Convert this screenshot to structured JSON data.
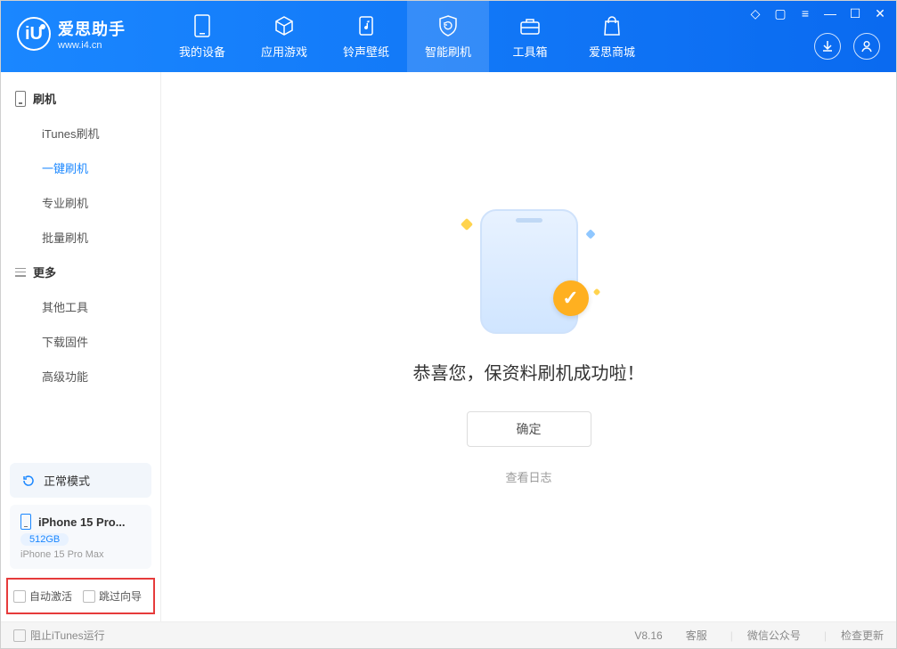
{
  "app": {
    "title": "爱思助手",
    "subtitle": "www.i4.cn",
    "logo_letter": "iU"
  },
  "nav": {
    "tabs": [
      {
        "label": "我的设备"
      },
      {
        "label": "应用游戏"
      },
      {
        "label": "铃声壁纸"
      },
      {
        "label": "智能刷机"
      },
      {
        "label": "工具箱"
      },
      {
        "label": "爱思商城"
      }
    ],
    "active_index": 3
  },
  "sidebar": {
    "section1_title": "刷机",
    "items1": [
      {
        "label": "iTunes刷机"
      },
      {
        "label": "一键刷机"
      },
      {
        "label": "专业刷机"
      },
      {
        "label": "批量刷机"
      }
    ],
    "active_item1": 1,
    "section2_title": "更多",
    "items2": [
      {
        "label": "其他工具"
      },
      {
        "label": "下载固件"
      },
      {
        "label": "高级功能"
      }
    ],
    "status": {
      "label": "正常模式"
    },
    "device": {
      "title": "iPhone 15 Pro...",
      "badge": "512GB",
      "sub": "iPhone 15 Pro Max"
    },
    "checks": {
      "auto_activate": "自动激活",
      "skip_guide": "跳过向导"
    }
  },
  "main": {
    "success_text": "恭喜您，保资料刷机成功啦！",
    "confirm_label": "确定",
    "view_log": "查看日志"
  },
  "footer": {
    "block_itunes": "阻止iTunes运行",
    "version": "V8.16",
    "links": [
      "客服",
      "微信公众号",
      "检查更新"
    ]
  }
}
